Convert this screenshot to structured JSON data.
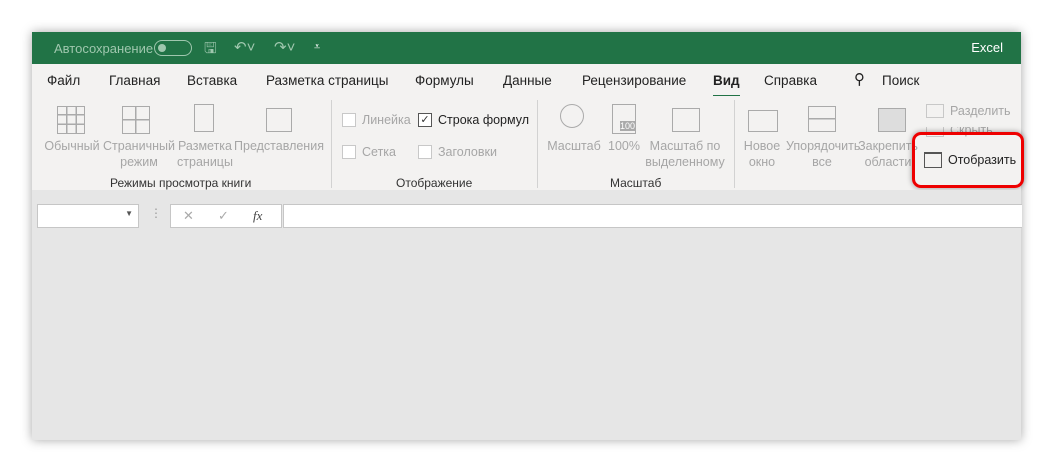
{
  "title_bar": {
    "autosave_label": "Автосохранение",
    "app_name": "Excel"
  },
  "tabs": [
    "Файл",
    "Главная",
    "Вставка",
    "Разметка страницы",
    "Формулы",
    "Данные",
    "Рецензирование",
    "Вид",
    "Справка"
  ],
  "search_label": "Поиск",
  "ribbon": {
    "views": {
      "buttons": [
        "Обычный",
        "Страничный режим",
        "Разметка страницы",
        "Представления"
      ],
      "group": "Режимы просмотра книги"
    },
    "show": {
      "checkboxes": [
        {
          "label": "Линейка",
          "checked": false
        },
        {
          "label": "Строка формул",
          "checked": true
        },
        {
          "label": "Сетка",
          "checked": false
        },
        {
          "label": "Заголовки",
          "checked": false
        }
      ],
      "group": "Отображение"
    },
    "zoom": {
      "buttons": [
        "Масштаб",
        "100%",
        "Масштаб по выделенному"
      ],
      "group": "Масштаб",
      "icon_text": "100"
    },
    "window": {
      "buttons": [
        "Новое окно",
        "Упорядочить все",
        "Закрепить области"
      ],
      "small": [
        "Разделить",
        "Скрыть",
        "Отобразить"
      ]
    }
  },
  "formula_bar": {
    "name_box": "",
    "cancel": "✕",
    "enter": "✓",
    "fx": "fx",
    "formula": ""
  },
  "highlight_color": "#e00000"
}
